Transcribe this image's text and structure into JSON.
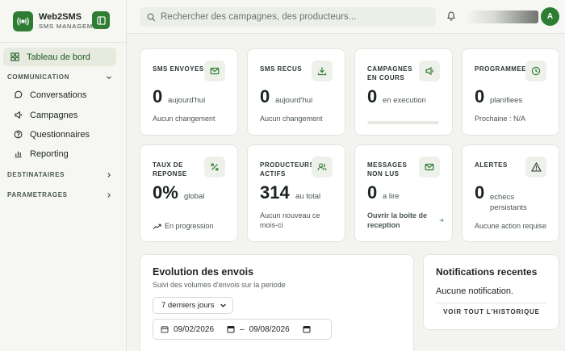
{
  "brand": {
    "name": "Web2SMS",
    "subtitle": "SMS MANAGEMENT"
  },
  "search": {
    "placeholder": "Rechercher des campagnes, des producteurs..."
  },
  "user": {
    "avatar_letter": "A"
  },
  "sidebar": {
    "items": [
      {
        "label": "Tableau de bord",
        "icon": "grid-icon",
        "active": true
      },
      {
        "label": "Conversations",
        "icon": "chat-icon"
      },
      {
        "label": "Campagnes",
        "icon": "megaphone-icon"
      },
      {
        "label": "Questionnaires",
        "icon": "question-icon"
      },
      {
        "label": "Reporting",
        "icon": "bar-chart-icon"
      }
    ],
    "sections": {
      "communication": "COMMUNICATION",
      "destinataires": "DESTINATAIRES",
      "parametrages": "PARAMETRAGES"
    }
  },
  "stats": [
    {
      "label": "SMS ENVOYES",
      "value": "0",
      "unit": "aujourd'hui",
      "foot": "Aucun changement",
      "icon": "mail-icon"
    },
    {
      "label": "SMS RECUS",
      "value": "0",
      "unit": "aujourd'hui",
      "foot": "Aucun changement",
      "icon": "download-icon"
    },
    {
      "label": "CAMPAGNES EN COURS",
      "value": "0",
      "unit": "en execution",
      "progress": 0,
      "icon": "megaphone-icon"
    },
    {
      "label": "PROGRAMMEES",
      "value": "0",
      "unit": "planifiees",
      "foot": "Prochaine : N/A",
      "icon": "clock-icon"
    },
    {
      "label": "TAUX DE REPONSE",
      "value": "0%",
      "unit": "global",
      "foot": "En progression",
      "icon": "percent-icon"
    },
    {
      "label": "PRODUCTEURS ACTIFS",
      "value": "314",
      "unit": "au total",
      "foot": "Aucun nouveau ce mois-ci",
      "icon": "users-icon"
    },
    {
      "label": "MESSAGES NON LUS",
      "value": "0",
      "unit": "a lire",
      "foot": "Ouvrir la boite de reception",
      "icon": "mail-icon"
    },
    {
      "label": "ALERTES",
      "value": "0",
      "unit": "echecs persistants",
      "foot": "Aucune action requise",
      "icon": "alert-icon"
    }
  ],
  "evolution": {
    "title": "Evolution des envois",
    "subtitle": "Suivi des volumes d'envois sur la periode",
    "period": "7 derniers jours",
    "date_from": "09/02/2026",
    "date_sep": "–",
    "date_to": "09/08/2026"
  },
  "notifications": {
    "title": "Notifications recentes",
    "empty": "Aucune notification.",
    "link": "VOIR TOUT L'HISTORIQUE"
  },
  "colors": {
    "accent": "#2f7d32",
    "background": "#f3f4f0",
    "card": "#ffffff"
  }
}
